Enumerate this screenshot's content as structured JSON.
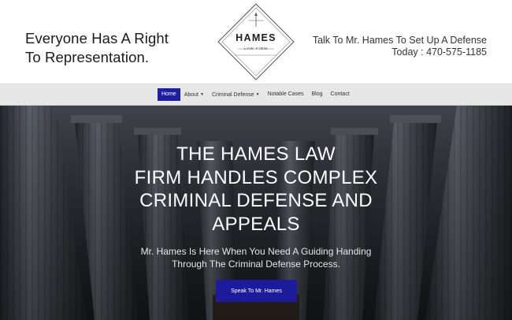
{
  "header": {
    "tagline_line1": "Everyone Has A Right",
    "tagline_line2": "To Representation.",
    "logo_name": "HAMES",
    "logo_sub": "LAW FIRM",
    "contact_line1": "Talk To Mr. Hames To Set Up A Defense",
    "contact_line2": "Today : 470-575-1185"
  },
  "nav": {
    "items": [
      {
        "label": "Home",
        "active": true
      },
      {
        "label": "About",
        "dropdown": true
      },
      {
        "label": "Criminal Defense",
        "dropdown": true
      },
      {
        "label": "Notable Cases"
      },
      {
        "label": "Blog"
      },
      {
        "label": "Contact"
      }
    ],
    "caret_glyph": "▼"
  },
  "hero": {
    "title_lines": [
      "THE HAMES LAW",
      "FIRM HANDLES COMPLEX",
      "CRIMINAL DEFENSE AND",
      "APPEALS"
    ],
    "subtitle_line1": "Mr. Hames Is Here When You Need A Guiding Handing",
    "subtitle_line2": "Through The Criminal Defense Process.",
    "cta_label": "Speak To Mr. Hames"
  },
  "colors": {
    "nav_active_bg": "#1e1e9f",
    "cta_bg": "#1b1b9c",
    "nav_bg": "#e7e7e7"
  }
}
